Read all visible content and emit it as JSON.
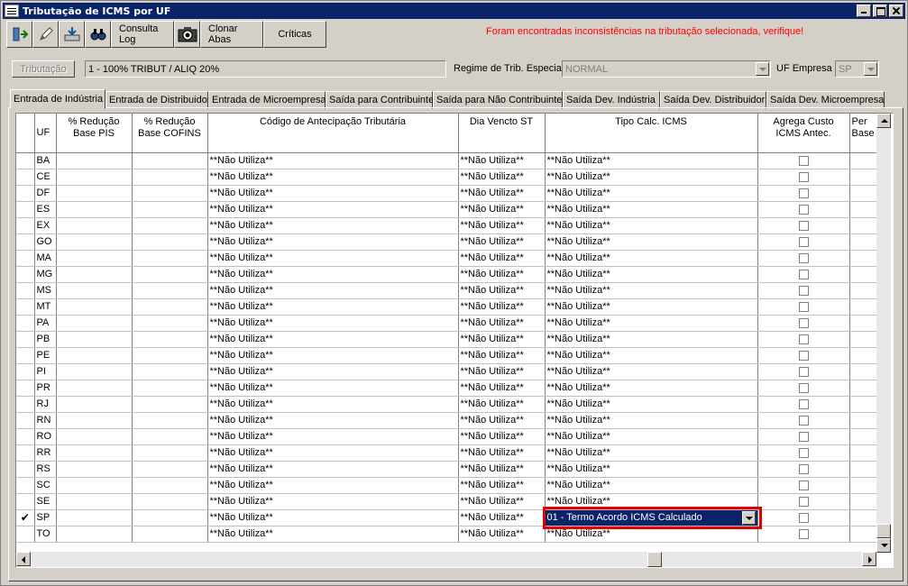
{
  "window": {
    "title": "Tributação de ICMS por UF"
  },
  "toolbar": {
    "icons": [
      "exit-icon",
      "edit-icon",
      "export-icon",
      "binoculars-icon"
    ],
    "consulta_log": "Consulta Log",
    "camera_icon": "camera-icon",
    "clonar_abas": "Clonar Abas",
    "criticas": "Críticas"
  },
  "warning": "Foram encontradas inconsistências na tributação selecionada, verifique!",
  "form": {
    "tributacao_button": "Tributação",
    "tributacao_value": "1  -  100% TRIBUT / ALIQ 20%",
    "regime_label": "Regime de Trib. Especial",
    "regime_value": "NORMAL",
    "uf_empresa_label": "UF Empresa",
    "uf_empresa_value": "SP"
  },
  "tabs": [
    {
      "label": "Entrada de Indústria",
      "active": true
    },
    {
      "label": "Entrada de Distribuidor"
    },
    {
      "label": "Entrada de Microempresa"
    },
    {
      "label": "Saída para Contribuinte"
    },
    {
      "label": "Saída para Não Contribuinte"
    },
    {
      "label": "Saída Dev. Indústria"
    },
    {
      "label": "Saída Dev. Distribuidor"
    },
    {
      "label": "Saída Dev. Microempresa"
    }
  ],
  "grid": {
    "columns": {
      "uf": "UF",
      "reducao_pis": "% Redução\nBase PIS",
      "reducao_cofins": "% Redução\nBase COFINS",
      "cod_antecipacao": "Código de Antecipação Tributária",
      "dia_vencto": "Dia Vencto ST",
      "tipo_calc": "Tipo Calc. ICMS",
      "agrega_custo": "Agrega Custo\nICMS Antec.",
      "partial": "Per\nBase"
    },
    "selected_marker": "✔",
    "rows": [
      {
        "uf": "BA",
        "cod": "**Não Utiliza**",
        "dia": "**Não Utiliza**",
        "tipo": "**Não Utiliza**"
      },
      {
        "uf": "CE",
        "cod": "**Não Utiliza**",
        "dia": "**Não Utiliza**",
        "tipo": "**Não Utiliza**"
      },
      {
        "uf": "DF",
        "cod": "**Não Utiliza**",
        "dia": "**Não Utiliza**",
        "tipo": "**Não Utiliza**"
      },
      {
        "uf": "ES",
        "cod": "**Não Utiliza**",
        "dia": "**Não Utiliza**",
        "tipo": "**Não Utiliza**"
      },
      {
        "uf": "EX",
        "cod": "**Não Utiliza**",
        "dia": "**Não Utiliza**",
        "tipo": "**Não Utiliza**"
      },
      {
        "uf": "GO",
        "cod": "**Não Utiliza**",
        "dia": "**Não Utiliza**",
        "tipo": "**Não Utiliza**"
      },
      {
        "uf": "MA",
        "cod": "**Não Utiliza**",
        "dia": "**Não Utiliza**",
        "tipo": "**Não Utiliza**"
      },
      {
        "uf": "MG",
        "cod": "**Não Utiliza**",
        "dia": "**Não Utiliza**",
        "tipo": "**Não Utiliza**"
      },
      {
        "uf": "MS",
        "cod": "**Não Utiliza**",
        "dia": "**Não Utiliza**",
        "tipo": "**Não Utiliza**"
      },
      {
        "uf": "MT",
        "cod": "**Não Utiliza**",
        "dia": "**Não Utiliza**",
        "tipo": "**Não Utiliza**"
      },
      {
        "uf": "PA",
        "cod": "**Não Utiliza**",
        "dia": "**Não Utiliza**",
        "tipo": "**Não Utiliza**"
      },
      {
        "uf": "PB",
        "cod": "**Não Utiliza**",
        "dia": "**Não Utiliza**",
        "tipo": "**Não Utiliza**"
      },
      {
        "uf": "PE",
        "cod": "**Não Utiliza**",
        "dia": "**Não Utiliza**",
        "tipo": "**Não Utiliza**"
      },
      {
        "uf": "PI",
        "cod": "**Não Utiliza**",
        "dia": "**Não Utiliza**",
        "tipo": "**Não Utiliza**"
      },
      {
        "uf": "PR",
        "cod": "**Não Utiliza**",
        "dia": "**Não Utiliza**",
        "tipo": "**Não Utiliza**"
      },
      {
        "uf": "RJ",
        "cod": "**Não Utiliza**",
        "dia": "**Não Utiliza**",
        "tipo": "**Não Utiliza**"
      },
      {
        "uf": "RN",
        "cod": "**Não Utiliza**",
        "dia": "**Não Utiliza**",
        "tipo": "**Não Utiliza**"
      },
      {
        "uf": "RO",
        "cod": "**Não Utiliza**",
        "dia": "**Não Utiliza**",
        "tipo": "**Não Utiliza**"
      },
      {
        "uf": "RR",
        "cod": "**Não Utiliza**",
        "dia": "**Não Utiliza**",
        "tipo": "**Não Utiliza**"
      },
      {
        "uf": "RS",
        "cod": "**Não Utiliza**",
        "dia": "**Não Utiliza**",
        "tipo": "**Não Utiliza**"
      },
      {
        "uf": "SC",
        "cod": "**Não Utiliza**",
        "dia": "**Não Utiliza**",
        "tipo": "**Não Utiliza**"
      },
      {
        "uf": "SE",
        "cod": "**Não Utiliza**",
        "dia": "**Não Utiliza**",
        "tipo": "**Não Utiliza**"
      },
      {
        "uf": "SP",
        "cod": "**Não Utiliza**",
        "dia": "**Não Utiliza**",
        "tipo": "01 - Termo Acordo ICMS Calculado",
        "selected": true
      },
      {
        "uf": "TO",
        "cod": "**Não Utiliza**",
        "dia": "**Não Utiliza**",
        "tipo": "**Não Utiliza**"
      }
    ]
  },
  "colors": {
    "titlebar": "#0a246a",
    "warning": "#ff0000",
    "highlight_box": "#e00000",
    "selection": "#0a246a"
  }
}
